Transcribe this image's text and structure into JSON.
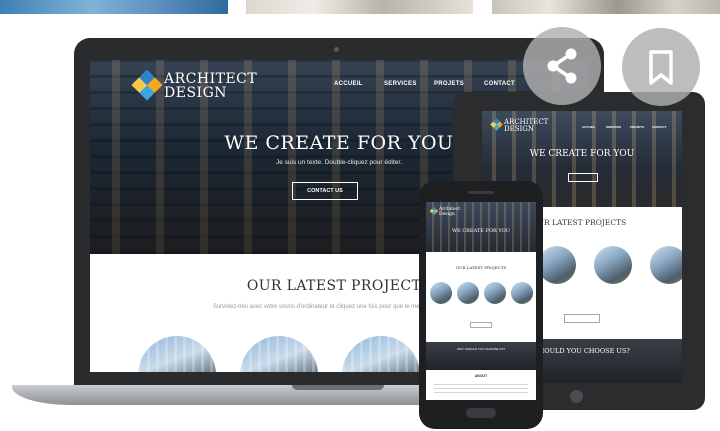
{
  "laptop": {
    "logo_line1": "ARCHITECT",
    "logo_line2": "DESIGN",
    "nav": [
      "ACCUEIL",
      "SERVICES",
      "PROJETS",
      "CONTACT"
    ],
    "hero_title": "WE CREATE FOR YOU",
    "hero_subtitle": "Je suis un texte. Double-cliquez pour éditer.",
    "hero_button": "CONTACT US",
    "projects_title": "OUR LATEST PROJECTS",
    "projects_subtitle": "Survolez-moi avec votre souris d'ordinateur et cliquez une fois pour que le menu s'affiche. D"
  },
  "tablet": {
    "logo_line1": "ARCHITECT",
    "logo_line2": "DESIGN",
    "nav": [
      "ACCUEIL",
      "SERVICES",
      "PROJETS",
      "CONTACT"
    ],
    "hero_title": "WE CREATE FOR YOU",
    "projects_title": "UR LATEST PROJECTS",
    "why_title": "SHOULD YOU CHOOSE US?"
  },
  "phone": {
    "logo_line1": "Architect",
    "logo_line2": "Design",
    "hero_title": "WE CREATE FOR YOU",
    "projects_title": "OUR LATEST PROJECTS",
    "why_title": "WHY SHOULD YOU CHOOSE US?",
    "about_title": "ABOUT"
  },
  "actions": {
    "share_icon": "share-icon",
    "bookmark_icon": "bookmark-icon"
  },
  "colors": {
    "accent_orange": "#f5a623",
    "accent_blue": "#3aa6e0",
    "device_frame": "#2a2b2d",
    "overlay_button": "#afafaf"
  }
}
